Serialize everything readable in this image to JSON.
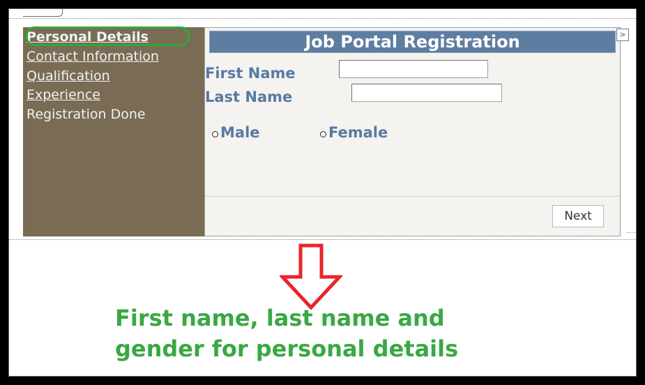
{
  "nav": {
    "items": [
      {
        "label": "Personal Details"
      },
      {
        "label": "Contact Information"
      },
      {
        "label": "Qualification"
      },
      {
        "label": "Experience"
      },
      {
        "label": "Registration Done"
      }
    ]
  },
  "panel": {
    "title": "Job Portal Registration",
    "first_name_label": "First Name",
    "first_name_value": "",
    "last_name_label": "Last Name",
    "last_name_value": "",
    "gender_options": [
      {
        "label": "Male",
        "selected": false
      },
      {
        "label": "Female",
        "selected": false
      }
    ],
    "next_label": "Next",
    "expand_glyph": ">"
  },
  "annotation": {
    "line1": "First name, last name and",
    "line2": "gender for personal details",
    "arrow_color": "#e8262a",
    "ring_color": "#2eaa32",
    "text_color": "#3aa843"
  },
  "theme": {
    "sidebar_bg": "#7a6b55",
    "header_bg": "#5d7ea1",
    "label_color": "#587aa2"
  }
}
